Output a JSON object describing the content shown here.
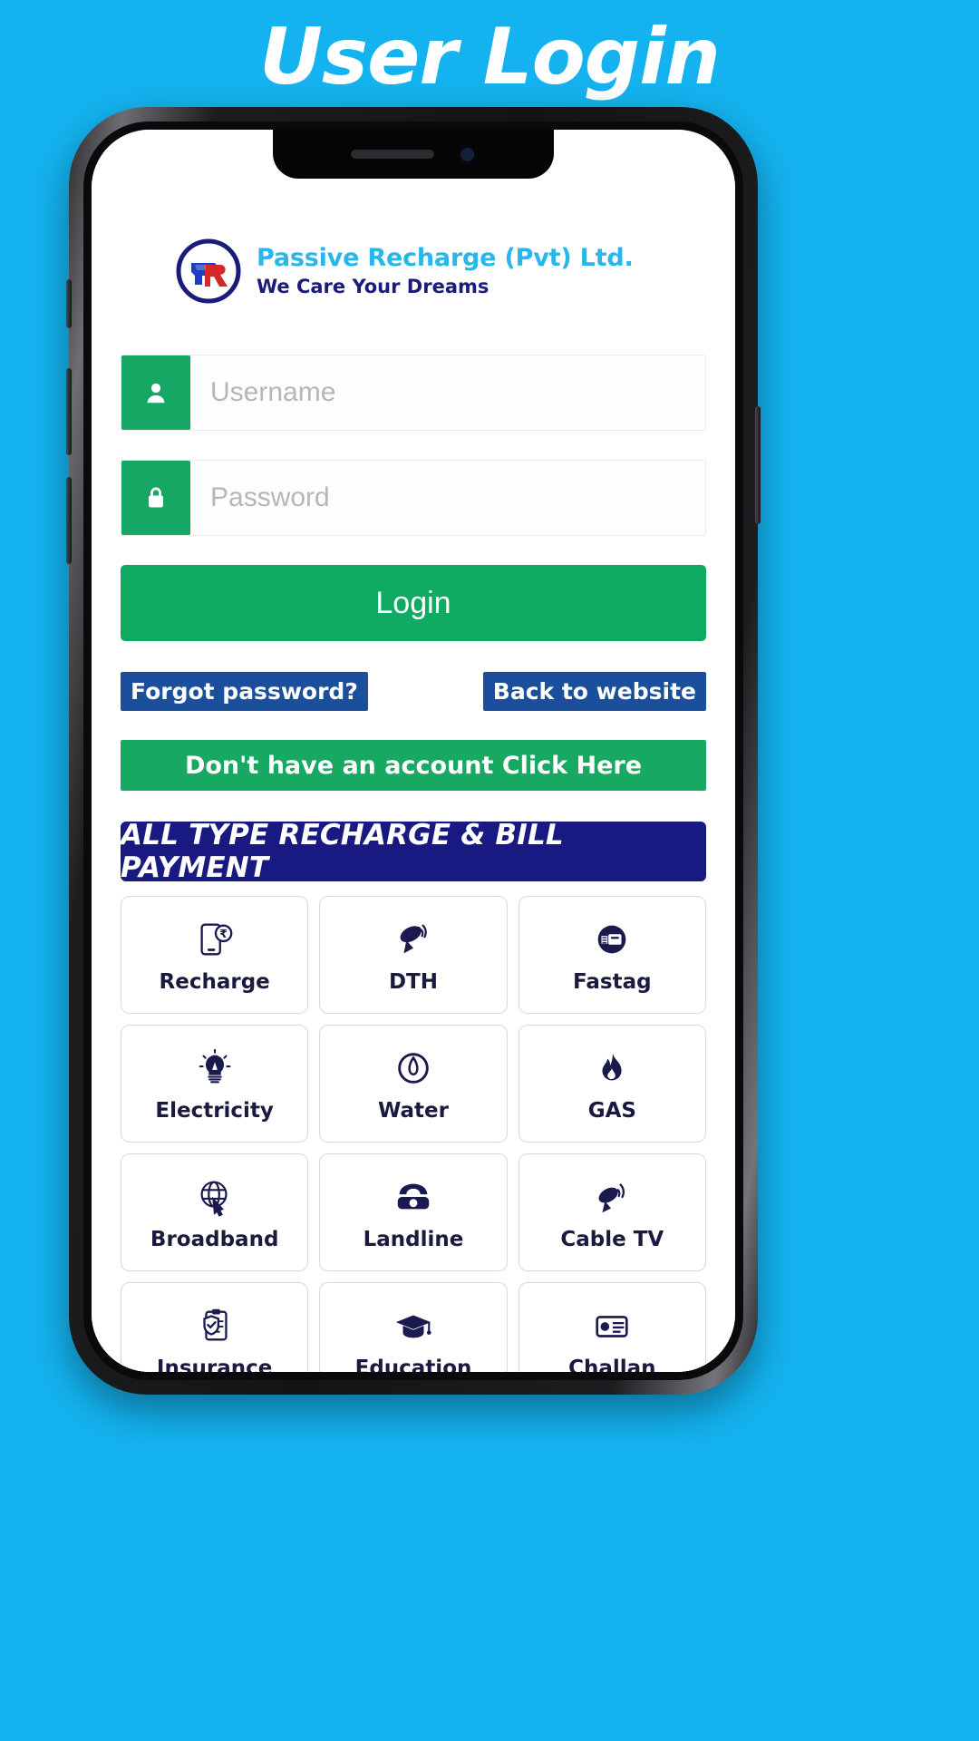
{
  "page": {
    "title": "User Login",
    "background_color": "#14b3f0"
  },
  "brand": {
    "logo_icon": "pr-monogram-logo",
    "name": "Passive Recharge (Pvt) Ltd.",
    "tagline": "We Care Your Dreams",
    "name_color": "#29b6e8",
    "tagline_color": "#1b1b7a"
  },
  "form": {
    "username": {
      "icon": "user-icon",
      "placeholder": "Username",
      "value": ""
    },
    "password": {
      "icon": "lock-icon",
      "placeholder": "Password",
      "value": ""
    },
    "login_label": "Login",
    "login_color": "#0fab62"
  },
  "links": {
    "forgot_password": "Forgot password?",
    "back_to_website": "Back to website",
    "badge_color": "#1b4f9c",
    "signup_banner": "Don't have an account Click Here",
    "signup_color": "#17a862"
  },
  "services": {
    "header": "ALL TYPE RECHARGE & BILL PAYMENT",
    "header_color": "#191982",
    "items": [
      {
        "label": "Recharge",
        "icon": "mobile-rupee-icon"
      },
      {
        "label": "DTH",
        "icon": "satellite-dish-icon"
      },
      {
        "label": "Fastag",
        "icon": "fastag-tag-icon"
      },
      {
        "label": "Electricity",
        "icon": "light-bulb-icon"
      },
      {
        "label": "Water",
        "icon": "water-drop-icon"
      },
      {
        "label": "GAS",
        "icon": "flame-icon"
      },
      {
        "label": "Broadband",
        "icon": "globe-cursor-icon"
      },
      {
        "label": "Landline",
        "icon": "telephone-icon"
      },
      {
        "label": "Cable TV",
        "icon": "cable-antenna-icon"
      },
      {
        "label": "Insurance",
        "icon": "insurance-clipboard-icon"
      },
      {
        "label": "Education",
        "icon": "graduation-cap-icon"
      },
      {
        "label": "Challan",
        "icon": "challan-card-icon"
      }
    ]
  },
  "device": {
    "notch_speaker": "speaker-grille",
    "front_camera": "front-camera"
  }
}
